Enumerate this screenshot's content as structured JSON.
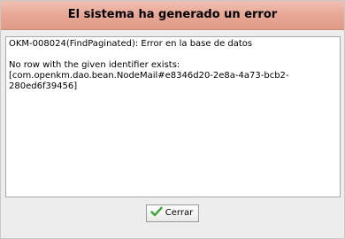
{
  "dialog": {
    "title": "El sistema ha generado un error",
    "message": {
      "line1": "OKM-008024(FindPaginated): Error en la base de datos",
      "line2": "No row with the given identifier exists:",
      "line3": "[com.openkm.dao.bean.NodeMail#e8346d20-2e8a-4a73-bcb2-",
      "line4": "280ed6f39456]"
    },
    "close_button_label": "Cerrar",
    "close_button_icon": "checkmark-icon",
    "colors": {
      "title_bar": "#e7a593",
      "checkmark": "#3aa82e"
    }
  }
}
